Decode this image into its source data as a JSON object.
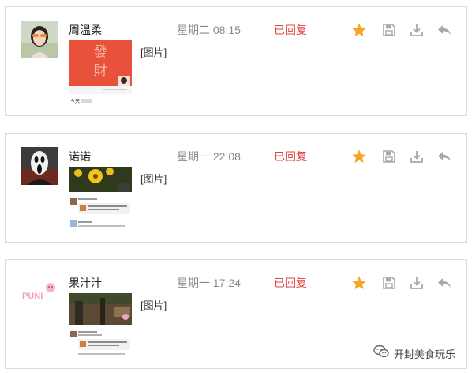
{
  "colors": {
    "accent_star": "#f5a623",
    "status_red": "#e0453b",
    "icon_gray": "#a9a9a9",
    "border": "#dcdcdc"
  },
  "messages": [
    {
      "sender": "周温柔",
      "time": "星期二 08:15",
      "status": "已回复",
      "image_tag": "[图片]",
      "starred": true,
      "thumb_label": "今天",
      "thumb_text": "发財"
    },
    {
      "sender": "诺诺",
      "time": "星期一 22:08",
      "status": "已回复",
      "image_tag": "[图片]",
      "starred": true
    },
    {
      "sender": "果汁汁",
      "time": "星期一 17:24",
      "status": "已回复",
      "image_tag": "[图片]",
      "starred": true
    }
  ],
  "icons": {
    "star": "star-icon",
    "save": "save-icon",
    "download": "download-icon",
    "reply": "reply-icon"
  },
  "watermark": {
    "text": "开封美食玩乐",
    "icon": "wechat-icon"
  }
}
